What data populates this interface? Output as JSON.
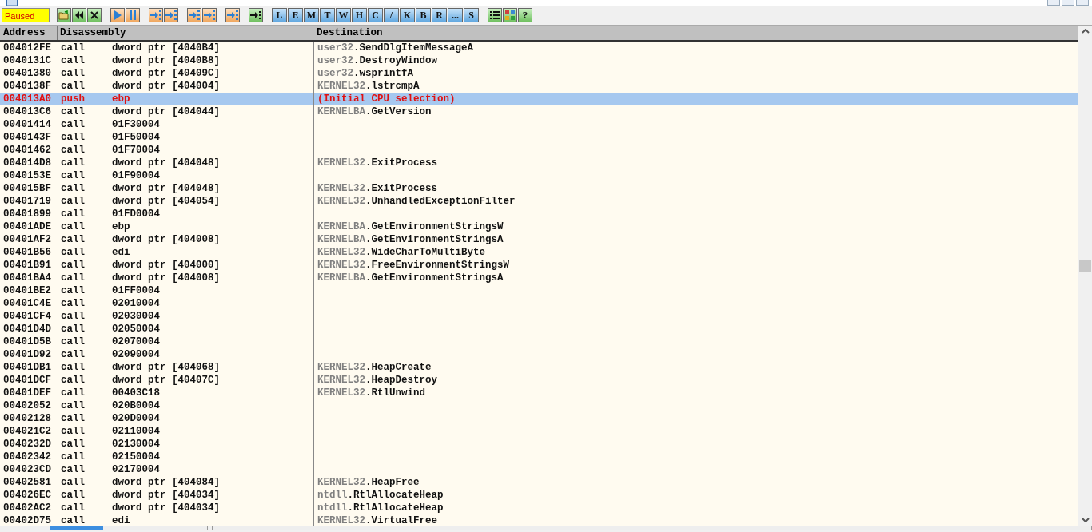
{
  "status": {
    "label": "Paused"
  },
  "toolbar": [
    {
      "kind": "folder"
    },
    {
      "kind": "rewind"
    },
    {
      "kind": "close"
    },
    {
      "kind": "gap"
    },
    {
      "kind": "play"
    },
    {
      "kind": "pause"
    },
    {
      "kind": "gap"
    },
    {
      "kind": "step"
    },
    {
      "kind": "step"
    },
    {
      "kind": "gap"
    },
    {
      "kind": "step"
    },
    {
      "kind": "step"
    },
    {
      "kind": "gap"
    },
    {
      "kind": "step"
    },
    {
      "kind": "gap"
    },
    {
      "kind": "goto"
    },
    {
      "kind": "gap"
    },
    {
      "kind": "letter",
      "label": "L"
    },
    {
      "kind": "letter",
      "label": "E"
    },
    {
      "kind": "letter",
      "label": "M"
    },
    {
      "kind": "letter",
      "label": "T"
    },
    {
      "kind": "letter",
      "label": "W"
    },
    {
      "kind": "letter",
      "label": "H"
    },
    {
      "kind": "letter",
      "label": "C"
    },
    {
      "kind": "letter",
      "label": "/"
    },
    {
      "kind": "letter",
      "label": "K"
    },
    {
      "kind": "letter",
      "label": "B"
    },
    {
      "kind": "letter",
      "label": "R"
    },
    {
      "kind": "letter",
      "label": "..."
    },
    {
      "kind": "letter",
      "label": "S"
    },
    {
      "kind": "gap"
    },
    {
      "kind": "list"
    },
    {
      "kind": "grid"
    },
    {
      "kind": "green",
      "label": "?"
    }
  ],
  "table": {
    "columns": [
      "Address",
      "Disassembly",
      "Destination"
    ],
    "rows": [
      {
        "address": "004012FE",
        "command": "call",
        "operand": "dword ptr [4040B4]",
        "module": "user32",
        "function": ".SendDlgItemMessageA",
        "selected": false
      },
      {
        "address": "0040131C",
        "command": "call",
        "operand": "dword ptr [4040B8]",
        "module": "user32",
        "function": ".DestroyWindow",
        "selected": false
      },
      {
        "address": "00401380",
        "command": "call",
        "operand": "dword ptr [40409C]",
        "module": "user32",
        "function": ".wsprintfA",
        "selected": false
      },
      {
        "address": "0040138F",
        "command": "call",
        "operand": "dword ptr [404004]",
        "module": "KERNEL32",
        "function": ".lstrcmpA",
        "selected": false
      },
      {
        "address": "004013A0",
        "command": "push",
        "operand": "ebp",
        "note": "(Initial CPU selection)",
        "selected": true
      },
      {
        "address": "004013C6",
        "command": "call",
        "operand": "dword ptr [404044]",
        "module": "KERNELBA",
        "function": ".GetVersion",
        "selected": false
      },
      {
        "address": "00401414",
        "command": "call",
        "operand": "01F30004",
        "selected": false
      },
      {
        "address": "0040143F",
        "command": "call",
        "operand": "01F50004",
        "selected": false
      },
      {
        "address": "00401462",
        "command": "call",
        "operand": "01F70004",
        "selected": false
      },
      {
        "address": "004014D8",
        "command": "call",
        "operand": "dword ptr [404048]",
        "module": "KERNEL32",
        "function": ".ExitProcess",
        "selected": false
      },
      {
        "address": "0040153E",
        "command": "call",
        "operand": "01F90004",
        "selected": false
      },
      {
        "address": "004015BF",
        "command": "call",
        "operand": "dword ptr [404048]",
        "module": "KERNEL32",
        "function": ".ExitProcess",
        "selected": false
      },
      {
        "address": "00401719",
        "command": "call",
        "operand": "dword ptr [404054]",
        "module": "KERNEL32",
        "function": ".UnhandledExceptionFilter",
        "selected": false
      },
      {
        "address": "00401899",
        "command": "call",
        "operand": "01FD0004",
        "selected": false
      },
      {
        "address": "00401ADE",
        "command": "call",
        "operand": "ebp",
        "module": "KERNELBA",
        "function": ".GetEnvironmentStringsW",
        "selected": false
      },
      {
        "address": "00401AF2",
        "command": "call",
        "operand": "dword ptr [404008]",
        "module": "KERNELBA",
        "function": ".GetEnvironmentStringsA",
        "selected": false
      },
      {
        "address": "00401B56",
        "command": "call",
        "operand": "edi",
        "module": "KERNEL32",
        "function": ".WideCharToMultiByte",
        "selected": false
      },
      {
        "address": "00401B91",
        "command": "call",
        "operand": "dword ptr [404000]",
        "module": "KERNEL32",
        "function": ".FreeEnvironmentStringsW",
        "selected": false
      },
      {
        "address": "00401BA4",
        "command": "call",
        "operand": "dword ptr [404008]",
        "module": "KERNELBA",
        "function": ".GetEnvironmentStringsA",
        "selected": false
      },
      {
        "address": "00401BE2",
        "command": "call",
        "operand": "01FF0004",
        "selected": false
      },
      {
        "address": "00401C4E",
        "command": "call",
        "operand": "02010004",
        "selected": false
      },
      {
        "address": "00401CF4",
        "command": "call",
        "operand": "02030004",
        "selected": false
      },
      {
        "address": "00401D4D",
        "command": "call",
        "operand": "02050004",
        "selected": false
      },
      {
        "address": "00401D5B",
        "command": "call",
        "operand": "02070004",
        "selected": false
      },
      {
        "address": "00401D92",
        "command": "call",
        "operand": "02090004",
        "selected": false
      },
      {
        "address": "00401DB1",
        "command": "call",
        "operand": "dword ptr [404068]",
        "module": "KERNEL32",
        "function": ".HeapCreate",
        "selected": false
      },
      {
        "address": "00401DCF",
        "command": "call",
        "operand": "dword ptr [40407C]",
        "module": "KERNEL32",
        "function": ".HeapDestroy",
        "selected": false
      },
      {
        "address": "00401DEF",
        "command": "call",
        "operand": "00403C18",
        "module": "KERNEL32",
        "function": ".RtlUnwind",
        "selected": false
      },
      {
        "address": "00402052",
        "command": "call",
        "operand": "020B0004",
        "selected": false
      },
      {
        "address": "00402128",
        "command": "call",
        "operand": "020D0004",
        "selected": false
      },
      {
        "address": "004021C2",
        "command": "call",
        "operand": "02110004",
        "selected": false
      },
      {
        "address": "0040232D",
        "command": "call",
        "operand": "02130004",
        "selected": false
      },
      {
        "address": "00402342",
        "command": "call",
        "operand": "02150004",
        "selected": false
      },
      {
        "address": "004023CD",
        "command": "call",
        "operand": "02170004",
        "selected": false
      },
      {
        "address": "00402581",
        "command": "call",
        "operand": "dword ptr [404084]",
        "module": "KERNEL32",
        "function": ".HeapFree",
        "selected": false
      },
      {
        "address": "004026EC",
        "command": "call",
        "operand": "dword ptr [404034]",
        "module": "ntdll",
        "function": ".RtlAllocateHeap",
        "selected": false
      },
      {
        "address": "00402AC2",
        "command": "call",
        "operand": "dword ptr [404034]",
        "module": "ntdll",
        "function": ".RtlAllocateHeap",
        "selected": false
      },
      {
        "address": "00402D75",
        "command": "call",
        "operand": "edi",
        "module": "KERNEL32",
        "function": ".VirtualFree",
        "selected": false
      }
    ]
  }
}
